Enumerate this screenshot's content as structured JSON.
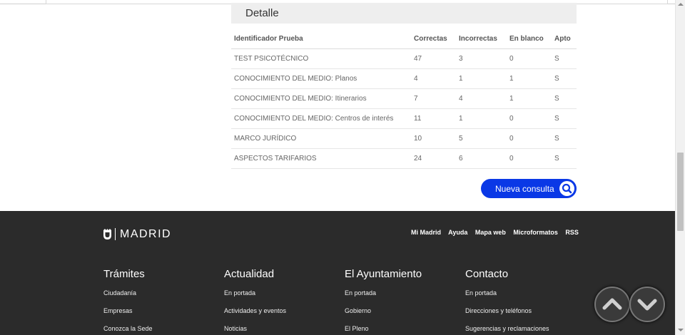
{
  "detalle": {
    "title": "Detalle",
    "columns": [
      "Identificador Prueba",
      "Correctas",
      "Incorrectas",
      "En blanco",
      "Apto"
    ],
    "rows": [
      [
        "TEST PSICOTÉCNICO",
        "47",
        "3",
        "0",
        "S"
      ],
      [
        "CONOCIMIENTO DEL MEDIO: Planos",
        "4",
        "1",
        "1",
        "S"
      ],
      [
        "CONOCIMIENTO DEL MEDIO: Itinerarios",
        "7",
        "4",
        "1",
        "S"
      ],
      [
        "CONOCIMIENTO DEL MEDIO: Centros de interés",
        "11",
        "1",
        "0",
        "S"
      ],
      [
        "MARCO JURÍDICO",
        "10",
        "5",
        "0",
        "S"
      ],
      [
        "ASPECTOS TARIFARIOS",
        "24",
        "6",
        "0",
        "S"
      ]
    ],
    "new_query_label": "Nueva consulta"
  },
  "footer": {
    "logo_text": "MADRID",
    "top_links": [
      "Mi Madrid",
      "Ayuda",
      "Mapa web",
      "Microformatos",
      "RSS"
    ],
    "columns": [
      {
        "title": "Trámites",
        "links": [
          "Ciudadanía",
          "Empresas",
          "Conozca la Sede"
        ]
      },
      {
        "title": "Actualidad",
        "links": [
          "En portada",
          "Actividades y eventos",
          "Noticias"
        ]
      },
      {
        "title": "El Ayuntamiento",
        "links": [
          "En portada",
          "Gobierno",
          "El Pleno"
        ]
      },
      {
        "title": "Contacto",
        "links": [
          "En portada",
          "Direcciones y teléfonos",
          "Sugerencias y reclamaciones"
        ]
      }
    ]
  },
  "colors": {
    "accent_blue": "#0a38e6",
    "footer_bg": "#2b2b2b",
    "header_bg": "#eeeeee"
  },
  "icons": {
    "search": "search-icon",
    "scroll_up": "chevron-up-icon",
    "scroll_down": "chevron-down-icon",
    "crest": "madrid-crest-icon"
  }
}
